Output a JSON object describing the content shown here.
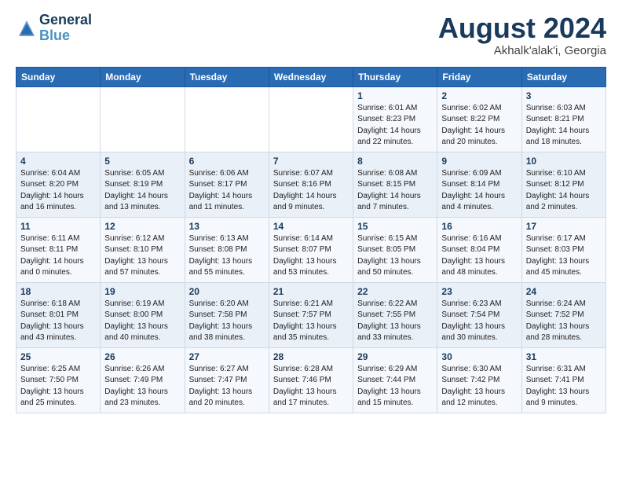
{
  "header": {
    "logo_general": "General",
    "logo_blue": "Blue",
    "month_year": "August 2024",
    "location": "Akhalk'alak'i, Georgia"
  },
  "weekdays": [
    "Sunday",
    "Monday",
    "Tuesday",
    "Wednesday",
    "Thursday",
    "Friday",
    "Saturday"
  ],
  "weeks": [
    [
      {
        "day": "",
        "info": ""
      },
      {
        "day": "",
        "info": ""
      },
      {
        "day": "",
        "info": ""
      },
      {
        "day": "",
        "info": ""
      },
      {
        "day": "1",
        "info": "Sunrise: 6:01 AM\nSunset: 8:23 PM\nDaylight: 14 hours\nand 22 minutes."
      },
      {
        "day": "2",
        "info": "Sunrise: 6:02 AM\nSunset: 8:22 PM\nDaylight: 14 hours\nand 20 minutes."
      },
      {
        "day": "3",
        "info": "Sunrise: 6:03 AM\nSunset: 8:21 PM\nDaylight: 14 hours\nand 18 minutes."
      }
    ],
    [
      {
        "day": "4",
        "info": "Sunrise: 6:04 AM\nSunset: 8:20 PM\nDaylight: 14 hours\nand 16 minutes."
      },
      {
        "day": "5",
        "info": "Sunrise: 6:05 AM\nSunset: 8:19 PM\nDaylight: 14 hours\nand 13 minutes."
      },
      {
        "day": "6",
        "info": "Sunrise: 6:06 AM\nSunset: 8:17 PM\nDaylight: 14 hours\nand 11 minutes."
      },
      {
        "day": "7",
        "info": "Sunrise: 6:07 AM\nSunset: 8:16 PM\nDaylight: 14 hours\nand 9 minutes."
      },
      {
        "day": "8",
        "info": "Sunrise: 6:08 AM\nSunset: 8:15 PM\nDaylight: 14 hours\nand 7 minutes."
      },
      {
        "day": "9",
        "info": "Sunrise: 6:09 AM\nSunset: 8:14 PM\nDaylight: 14 hours\nand 4 minutes."
      },
      {
        "day": "10",
        "info": "Sunrise: 6:10 AM\nSunset: 8:12 PM\nDaylight: 14 hours\nand 2 minutes."
      }
    ],
    [
      {
        "day": "11",
        "info": "Sunrise: 6:11 AM\nSunset: 8:11 PM\nDaylight: 14 hours\nand 0 minutes."
      },
      {
        "day": "12",
        "info": "Sunrise: 6:12 AM\nSunset: 8:10 PM\nDaylight: 13 hours\nand 57 minutes."
      },
      {
        "day": "13",
        "info": "Sunrise: 6:13 AM\nSunset: 8:08 PM\nDaylight: 13 hours\nand 55 minutes."
      },
      {
        "day": "14",
        "info": "Sunrise: 6:14 AM\nSunset: 8:07 PM\nDaylight: 13 hours\nand 53 minutes."
      },
      {
        "day": "15",
        "info": "Sunrise: 6:15 AM\nSunset: 8:05 PM\nDaylight: 13 hours\nand 50 minutes."
      },
      {
        "day": "16",
        "info": "Sunrise: 6:16 AM\nSunset: 8:04 PM\nDaylight: 13 hours\nand 48 minutes."
      },
      {
        "day": "17",
        "info": "Sunrise: 6:17 AM\nSunset: 8:03 PM\nDaylight: 13 hours\nand 45 minutes."
      }
    ],
    [
      {
        "day": "18",
        "info": "Sunrise: 6:18 AM\nSunset: 8:01 PM\nDaylight: 13 hours\nand 43 minutes."
      },
      {
        "day": "19",
        "info": "Sunrise: 6:19 AM\nSunset: 8:00 PM\nDaylight: 13 hours\nand 40 minutes."
      },
      {
        "day": "20",
        "info": "Sunrise: 6:20 AM\nSunset: 7:58 PM\nDaylight: 13 hours\nand 38 minutes."
      },
      {
        "day": "21",
        "info": "Sunrise: 6:21 AM\nSunset: 7:57 PM\nDaylight: 13 hours\nand 35 minutes."
      },
      {
        "day": "22",
        "info": "Sunrise: 6:22 AM\nSunset: 7:55 PM\nDaylight: 13 hours\nand 33 minutes."
      },
      {
        "day": "23",
        "info": "Sunrise: 6:23 AM\nSunset: 7:54 PM\nDaylight: 13 hours\nand 30 minutes."
      },
      {
        "day": "24",
        "info": "Sunrise: 6:24 AM\nSunset: 7:52 PM\nDaylight: 13 hours\nand 28 minutes."
      }
    ],
    [
      {
        "day": "25",
        "info": "Sunrise: 6:25 AM\nSunset: 7:50 PM\nDaylight: 13 hours\nand 25 minutes."
      },
      {
        "day": "26",
        "info": "Sunrise: 6:26 AM\nSunset: 7:49 PM\nDaylight: 13 hours\nand 23 minutes."
      },
      {
        "day": "27",
        "info": "Sunrise: 6:27 AM\nSunset: 7:47 PM\nDaylight: 13 hours\nand 20 minutes."
      },
      {
        "day": "28",
        "info": "Sunrise: 6:28 AM\nSunset: 7:46 PM\nDaylight: 13 hours\nand 17 minutes."
      },
      {
        "day": "29",
        "info": "Sunrise: 6:29 AM\nSunset: 7:44 PM\nDaylight: 13 hours\nand 15 minutes."
      },
      {
        "day": "30",
        "info": "Sunrise: 6:30 AM\nSunset: 7:42 PM\nDaylight: 13 hours\nand 12 minutes."
      },
      {
        "day": "31",
        "info": "Sunrise: 6:31 AM\nSunset: 7:41 PM\nDaylight: 13 hours\nand 9 minutes."
      }
    ]
  ]
}
